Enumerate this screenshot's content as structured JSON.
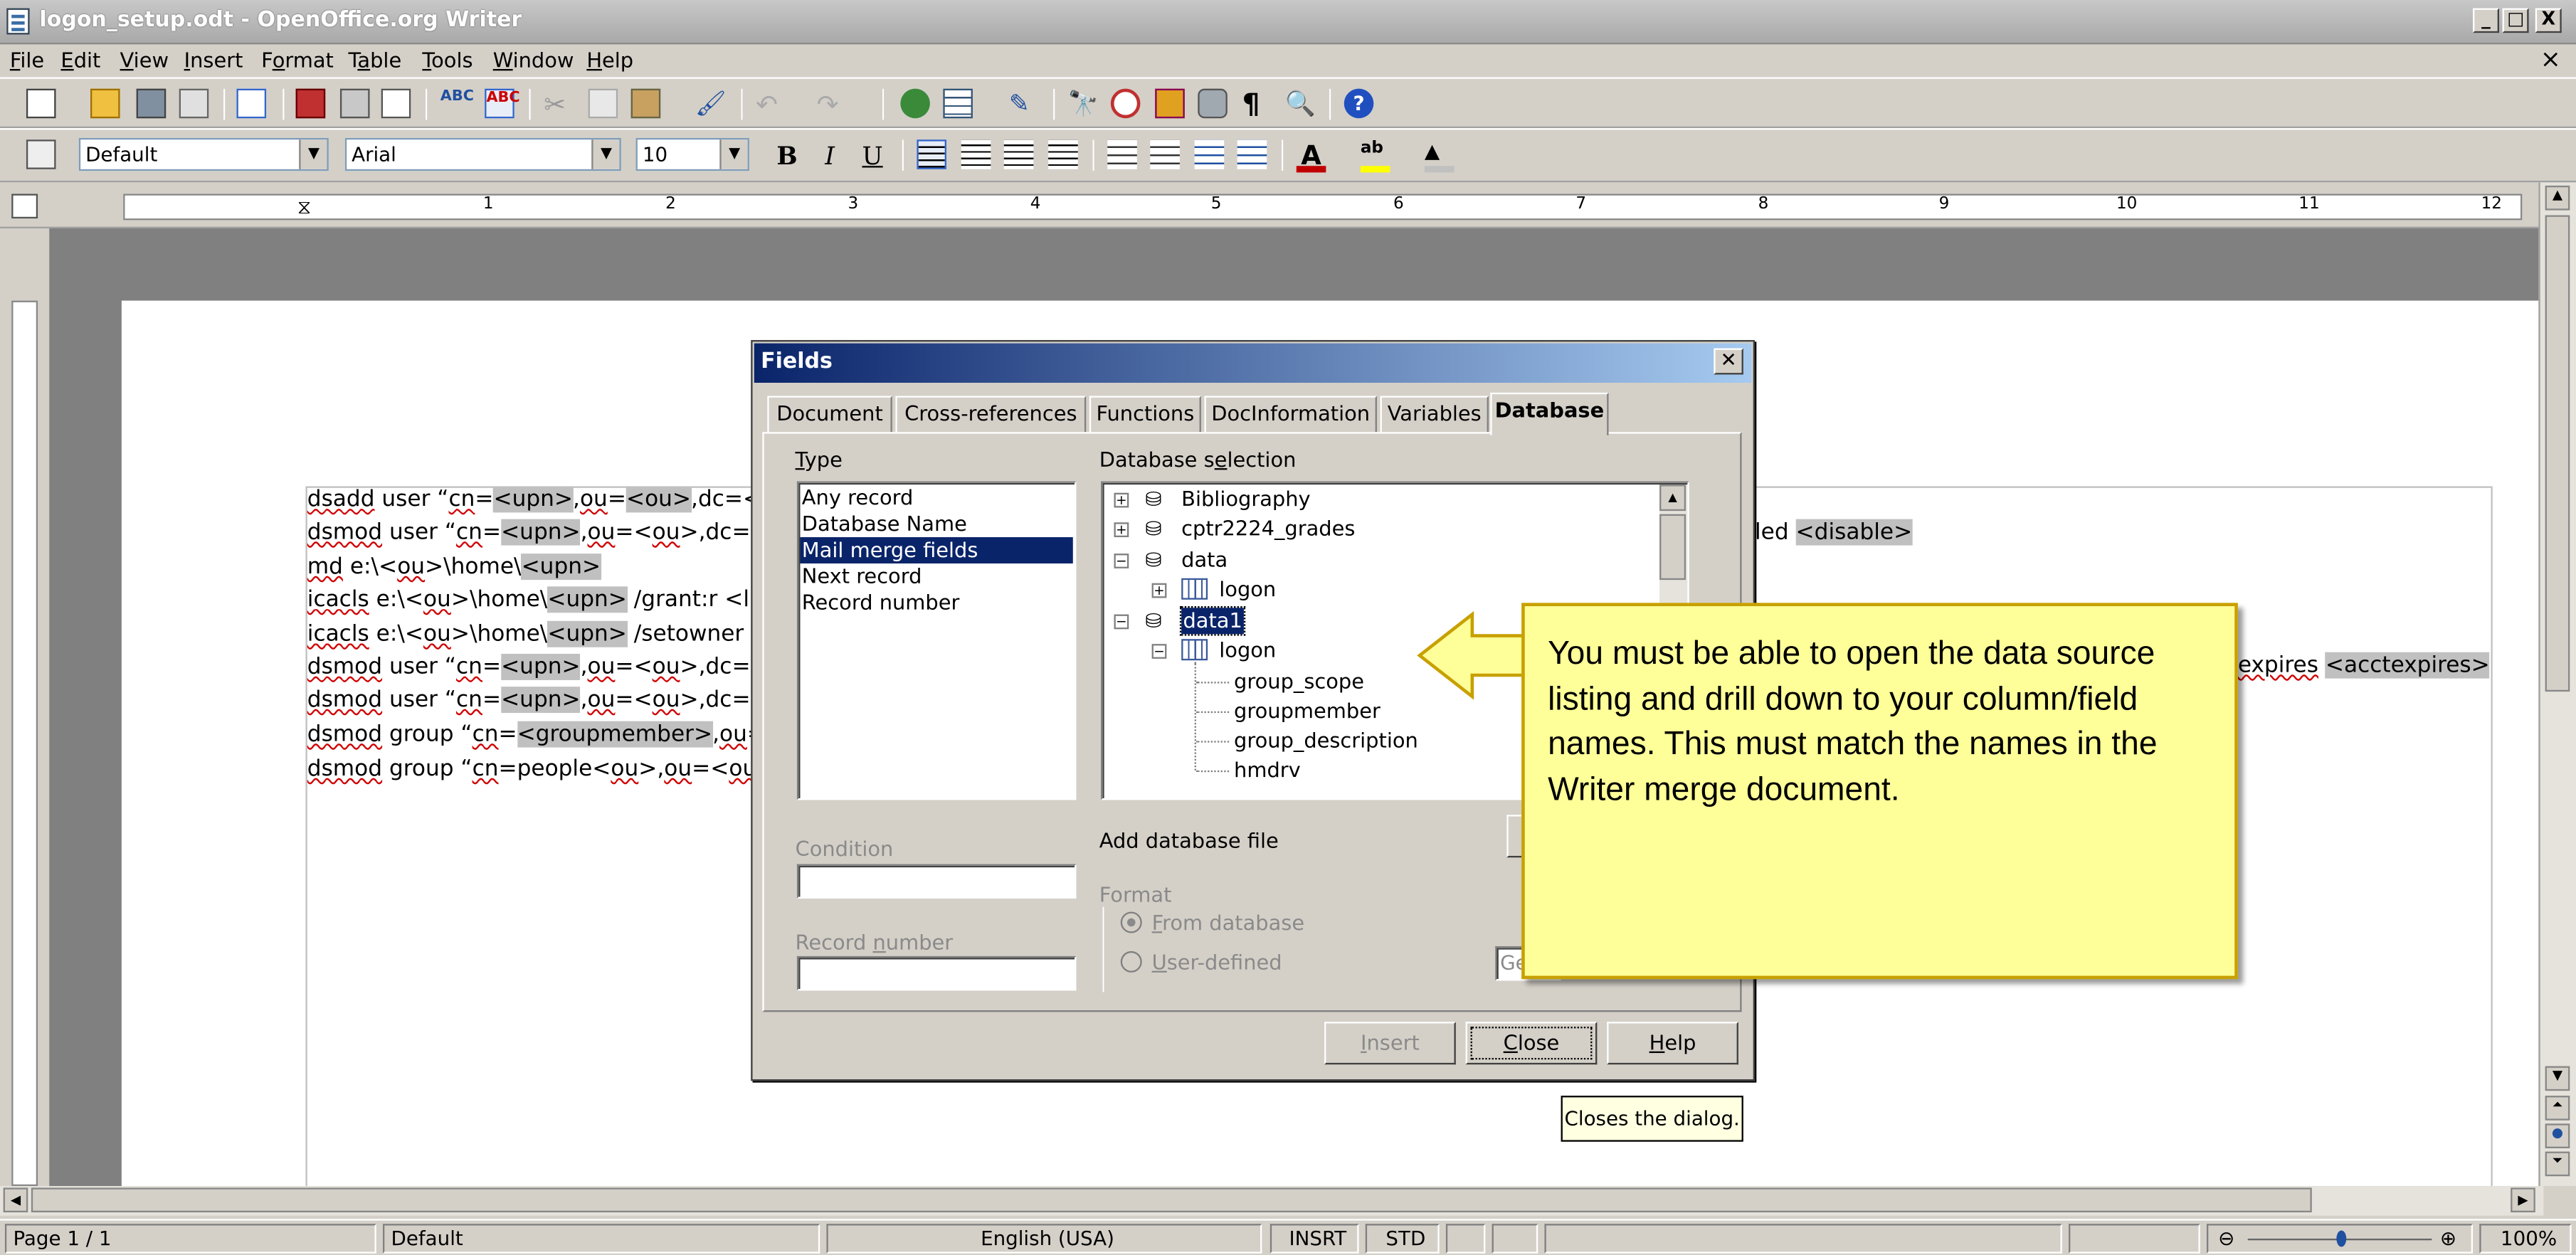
{
  "window": {
    "title": "logon_setup.odt - OpenOffice.org Writer",
    "min": "_",
    "max": "□",
    "close": "X",
    "doc_close": "×"
  },
  "menu": [
    {
      "pre": "",
      "u": "F",
      "post": "ile"
    },
    {
      "pre": "",
      "u": "E",
      "post": "dit"
    },
    {
      "pre": "",
      "u": "V",
      "post": "iew"
    },
    {
      "pre": "",
      "u": "I",
      "post": "nsert"
    },
    {
      "pre": "F",
      "u": "o",
      "post": "rmat"
    },
    {
      "pre": "T",
      "u": "a",
      "post": "ble"
    },
    {
      "pre": "",
      "u": "T",
      "post": "ools"
    },
    {
      "pre": "",
      "u": "W",
      "post": "indow"
    },
    {
      "pre": "",
      "u": "H",
      "post": "elp"
    }
  ],
  "format_toolbar": {
    "style": "Default",
    "font": "Arial",
    "size": "10",
    "bold": "B",
    "italic": "I",
    "underline": "U"
  },
  "ruler": {
    "numbers": [
      "1",
      "2",
      "3",
      "4",
      "5",
      "6",
      "7",
      "8",
      "9",
      "10",
      "11",
      "12"
    ]
  },
  "document": {
    "lines": [
      [
        {
          "t": "dsadd",
          "sq": true
        },
        {
          "t": " user “"
        },
        {
          "t": "cn",
          "sq": true
        },
        {
          "t": "="
        },
        {
          "t": "<upn>",
          "hl": true
        },
        {
          "t": ","
        },
        {
          "t": "ou",
          "sq": true
        },
        {
          "t": "="
        },
        {
          "t": "<ou>",
          "hl": true
        },
        {
          "t": ",dc=<dc"
        }
      ],
      [
        {
          "t": "dsmod",
          "sq": true
        },
        {
          "t": " user “"
        },
        {
          "t": "cn",
          "sq": true
        },
        {
          "t": "="
        },
        {
          "t": "<upn>",
          "hl": true
        },
        {
          "t": ","
        },
        {
          "t": "ou",
          "sq": true
        },
        {
          "t": "=<"
        },
        {
          "t": "ou",
          "sq": true
        },
        {
          "t": ">,dc=<d"
        }
      ],
      [
        {
          "t": "md",
          "sq": true
        },
        {
          "t": " e:\\<"
        },
        {
          "t": "ou",
          "sq": true
        },
        {
          "t": ">\\home\\"
        },
        {
          "t": "<upn>",
          "hl": true
        }
      ],
      [
        {
          "t": "icacls",
          "sq": true
        },
        {
          "t": " e:\\<"
        },
        {
          "t": "ou",
          "sq": true
        },
        {
          "t": ">\\home\\"
        },
        {
          "t": "<upn>",
          "hl": true
        },
        {
          "t": " /grant:r  <ln"
        }
      ],
      [
        {
          "t": "icacls",
          "sq": true
        },
        {
          "t": " e:\\<"
        },
        {
          "t": "ou",
          "sq": true
        },
        {
          "t": ">\\home\\"
        },
        {
          "t": "<upn>",
          "hl": true
        },
        {
          "t": " /setowner <"
        }
      ],
      [
        {
          "t": "dsmod",
          "sq": true
        },
        {
          "t": " user “"
        },
        {
          "t": "cn",
          "sq": true
        },
        {
          "t": "="
        },
        {
          "t": "<upn>",
          "hl": true
        },
        {
          "t": ","
        },
        {
          "t": "ou",
          "sq": true
        },
        {
          "t": "=<"
        },
        {
          "t": "ou",
          "sq": true
        },
        {
          "t": ">,dc=<d"
        }
      ],
      [
        {
          "t": "dsmod",
          "sq": true
        },
        {
          "t": " user “"
        },
        {
          "t": "cn",
          "sq": true
        },
        {
          "t": "="
        },
        {
          "t": "<upn>",
          "hl": true
        },
        {
          "t": ","
        },
        {
          "t": "ou",
          "sq": true
        },
        {
          "t": "=<"
        },
        {
          "t": "ou",
          "sq": true
        },
        {
          "t": ">,dc=<d"
        }
      ],
      [
        {
          "t": "dsmod",
          "sq": true
        },
        {
          "t": " group “"
        },
        {
          "t": "cn",
          "sq": true
        },
        {
          "t": "="
        },
        {
          "t": "<groupmember>",
          "hl": true
        },
        {
          "t": ","
        },
        {
          "t": "ou",
          "sq": true
        },
        {
          "t": "="
        }
      ],
      [
        {
          "t": "dsmod",
          "sq": true
        },
        {
          "t": " group “"
        },
        {
          "t": "cn",
          "sq": true
        },
        {
          "t": "=people<"
        },
        {
          "t": "ou",
          "sq": true
        },
        {
          "t": ">,"
        },
        {
          "t": "ou",
          "sq": true
        },
        {
          "t": "=<"
        },
        {
          "t": "ou",
          "sq": true
        },
        {
          "t": ">"
        }
      ]
    ],
    "right_fragment_1_pre": "led ",
    "right_fragment_1_hl": "<disable>",
    "right_fragment_2_pre": "expires",
    "right_fragment_2_hl": "<acctexpires>"
  },
  "dialog": {
    "title": "Fields",
    "close": "✕",
    "tabs": [
      "Document",
      "Cross-references",
      "Functions",
      "DocInformation",
      "Variables",
      "Database"
    ],
    "type_label_u": "T",
    "type_label_rest": "ype",
    "type_items": [
      "Any record",
      "Database Name",
      "Mail merge fields",
      "Next record",
      "Record number"
    ],
    "db_selection_pre": "Database s",
    "db_selection_u": "e",
    "db_selection_post": "lection",
    "tree": {
      "root_nodes": [
        "Bibliography",
        "cptr2224_grades",
        "data"
      ],
      "data_child": "logon",
      "data1": "data1",
      "data1_child": "logon",
      "fields": [
        "group_scope",
        "groupmember",
        "group_description",
        "hmdrv"
      ]
    },
    "add_db_file": "Add database file",
    "condition": "Condition",
    "record_number_pre": "Record ",
    "record_number_u": "n",
    "record_number_post": "umber",
    "format_label": "Format",
    "from_db_u": "F",
    "from_db_rest": "rom database",
    "user_def_u": "U",
    "user_def_rest": "ser-defined",
    "general_partial": "Ge",
    "buttons": {
      "insert_u": "I",
      "insert_rest": "nsert",
      "close_u": "C",
      "close_rest": "lose",
      "help_u": "H",
      "help_rest": "elp"
    }
  },
  "callout": {
    "text": "You must be able to open the data source listing and drill down to your column/field names. This must match the names in the Writer merge document."
  },
  "tooltip": {
    "text": "Closes the dialog."
  },
  "status": {
    "page": "Page 1 / 1",
    "style": "Default",
    "language": "English (USA)",
    "insert": "INSRT",
    "selection": "STD",
    "zoom": "100%"
  },
  "colors": {
    "callout_bg": "#ffff99",
    "selection": "#0a246a",
    "dialog_title_start": "#0a246a"
  }
}
